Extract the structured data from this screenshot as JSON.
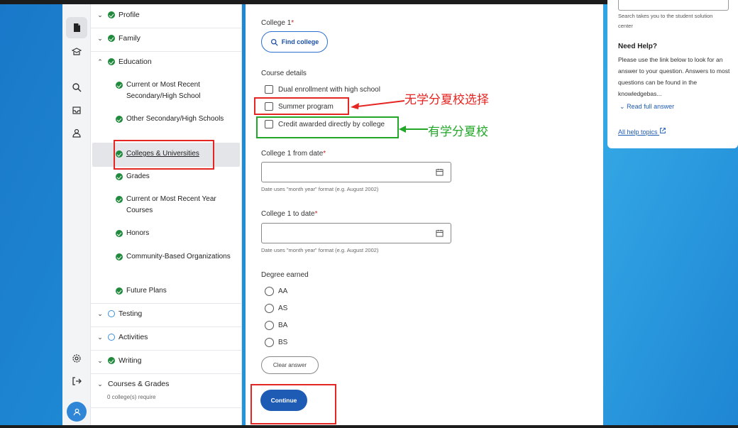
{
  "nav": {
    "profile": "Profile",
    "family": "Family",
    "education": "Education",
    "education_items": [
      {
        "label": "Current or Most Recent Secondary/High School"
      },
      {
        "label": "Other Secondary/High Schools"
      },
      {
        "label": "Colleges & Universities"
      },
      {
        "label": "Grades"
      },
      {
        "label": "Current or Most Recent Year Courses"
      },
      {
        "label": "Honors"
      },
      {
        "label": "Community-Based Organizations"
      },
      {
        "label": "Future Plans"
      }
    ],
    "testing": "Testing",
    "activities": "Activities",
    "writing": "Writing",
    "courses_grades": "Courses & Grades",
    "courses_grades_note": "0 college(s) require"
  },
  "main": {
    "college_label": "College 1",
    "required_mark": "*",
    "find_college": "Find college",
    "course_details": "Course details",
    "options": [
      {
        "label": "Dual enrollment with high school"
      },
      {
        "label": "Summer program"
      },
      {
        "label": "Credit awarded directly by college"
      }
    ],
    "from_date_label": "College 1 from date",
    "to_date_label": "College 1 to date",
    "date_hint": "Date uses \"month year\" format (e.g. August 2002)",
    "degree_label": "Degree earned",
    "degrees": [
      "AA",
      "AS",
      "BA",
      "BS"
    ],
    "clear_answer": "Clear answer",
    "continue": "Continue"
  },
  "help": {
    "search_note": "Search takes you to the student solution center",
    "title": "Need Help?",
    "body": "Please use the link below to look for an answer to your question. Answers to most questions can be found in the knowledgebas...",
    "read_full": "Read full answer",
    "all_topics": "All help topics"
  },
  "annotations": {
    "red_text": "无学分夏校选择",
    "green_text": "有学分夏校",
    "red_color": "#e52521",
    "green_color": "#22a728"
  }
}
